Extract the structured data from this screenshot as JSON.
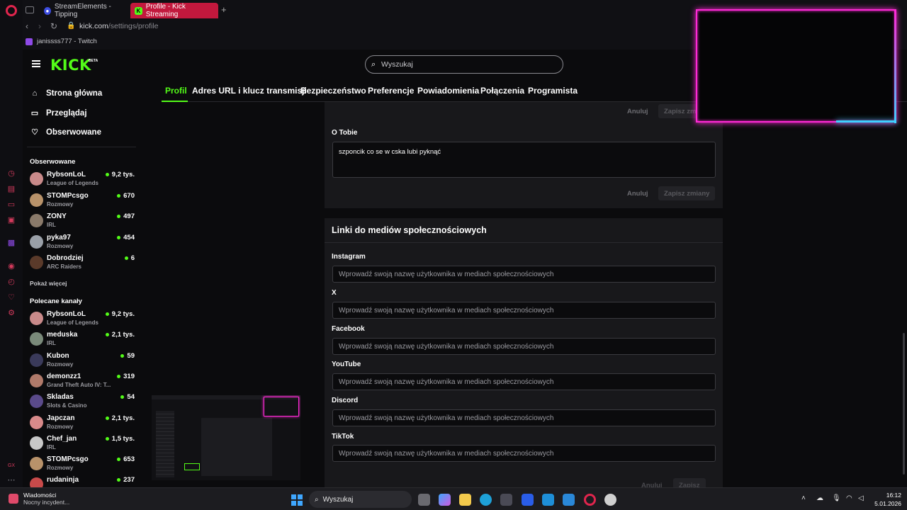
{
  "browser": {
    "tabs": [
      {
        "label": "StreamElements - Tipping",
        "favicon": "streamelements-icon"
      },
      {
        "label": "Profile - Kick Streaming",
        "favicon": "kick-icon",
        "active": true
      }
    ],
    "url_domain": "kick.com",
    "url_path": "/settings/profile",
    "bookmark": "janissss777 - Twitch"
  },
  "header": {
    "logo": "KICK",
    "logo_badge": "BETA",
    "search_placeholder": "Wyszukaj"
  },
  "settings_tabs": [
    "Profil",
    "Adres URL i klucz transmisji",
    "Bezpieczeństwo",
    "Preferencje",
    "Powiadomienia",
    "Połączenia",
    "Programista"
  ],
  "sidebar": {
    "nav": [
      {
        "label": "Strona główna",
        "icon": "home-icon"
      },
      {
        "label": "Przeglądaj",
        "icon": "browse-icon"
      },
      {
        "label": "Obserwowane",
        "icon": "heart-icon"
      }
    ],
    "followed_heading": "Obserwowane",
    "followed": [
      {
        "name": "RybsonLoL",
        "category": "League of Legends",
        "viewers": "9,2 tys.",
        "avatar_color": "#c98a8a"
      },
      {
        "name": "STOMPcsgo",
        "category": "Rozmowy",
        "viewers": "670",
        "avatar_color": "#b8926a"
      },
      {
        "name": "ZONY",
        "category": "IRL",
        "viewers": "497",
        "avatar_color": "#8a7a6a"
      },
      {
        "name": "pyka97",
        "category": "Rozmowy",
        "viewers": "454",
        "avatar_color": "#9aa0a8"
      },
      {
        "name": "Dobrodziej",
        "category": "ARC Raiders",
        "viewers": "6",
        "avatar_color": "#5a3a2a"
      }
    ],
    "show_more": "Pokaż więcej",
    "recommended_heading": "Polecane kanały",
    "recommended": [
      {
        "name": "RybsonLoL",
        "category": "League of Legends",
        "viewers": "9,2 tys.",
        "avatar_color": "#c98a8a"
      },
      {
        "name": "meduska",
        "category": "IRL",
        "viewers": "2,1 tys.",
        "avatar_color": "#7a8a7a"
      },
      {
        "name": "Kubon",
        "category": "Rozmowy",
        "viewers": "59",
        "avatar_color": "#3a3a5a"
      },
      {
        "name": "demonzz1",
        "category": "Grand Theft Auto IV: T...",
        "viewers": "319",
        "avatar_color": "#b07a6a"
      },
      {
        "name": "Skladas",
        "category": "Slots & Casino",
        "viewers": "54",
        "avatar_color": "#5a4a8a"
      },
      {
        "name": "Japczan",
        "category": "Rozmowy",
        "viewers": "2,1 tys.",
        "avatar_color": "#d88a8a"
      },
      {
        "name": "Chef_jan",
        "category": "IRL",
        "viewers": "1,5 tys.",
        "avatar_color": "#c8c8c8"
      },
      {
        "name": "STOMPcsgo",
        "category": "Rozmowy",
        "viewers": "653",
        "avatar_color": "#b8926a"
      },
      {
        "name": "rudaninja",
        "category": "",
        "viewers": "237",
        "avatar_color": "#c84a4a"
      }
    ]
  },
  "profile": {
    "top_cancel": "Anuluj",
    "top_save": "Zapisz zmi",
    "about_label": "O Tobie",
    "about_value": "szponcik co se w cska lubi pyknąć",
    "about_cancel": "Anuluj",
    "about_save": "Zapisz zmiany",
    "social_title": "Linki do mediów społecznościowych",
    "social_placeholder": "Wprowadź swoją nazwę użytkownika w mediach społecznościowych",
    "social_fields": [
      "Instagram",
      "X",
      "Facebook",
      "YouTube",
      "Discord",
      "TikTok"
    ],
    "social_cancel": "Anuluj",
    "social_save": "Zapisz"
  },
  "taskbar": {
    "widget_title": "Wiadomości",
    "widget_sub": "Nocny incydent...",
    "search_label": "Wyszukaj",
    "time": "16:12",
    "date": "5.01.2026"
  },
  "colors": {
    "kick_green": "#53fc18",
    "neon_pink": "#ff29d6",
    "neon_cyan": "#3fd0ff",
    "opera_red": "#e0254d"
  }
}
